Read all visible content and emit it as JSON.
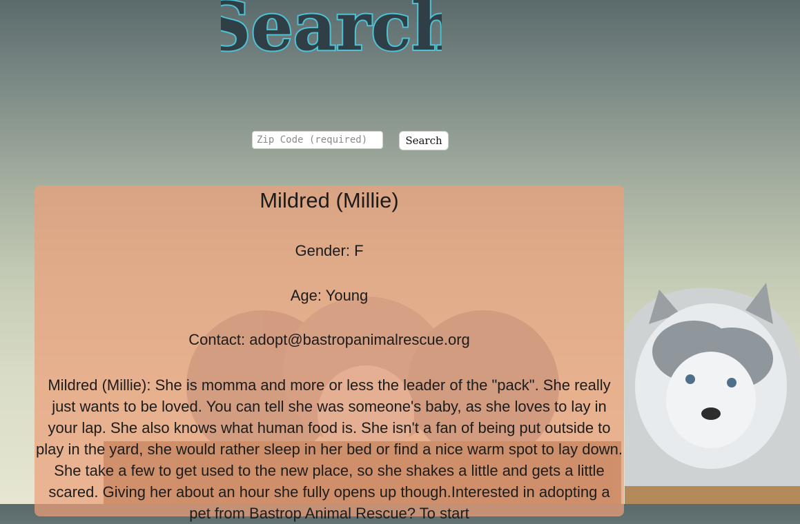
{
  "header": {
    "title": "Search"
  },
  "search": {
    "zip_placeholder": "Zip Code (required)",
    "zip_value": "",
    "button_label": "Search"
  },
  "pet": {
    "name": "Mildred (Millie)",
    "gender_label": "Gender: F",
    "age_label": "Age: Young",
    "contact_prefix": "Contact: ",
    "contact_email": "adopt@bastropanimalrescue.org",
    "description": "Mildred (Millie): She is momma and more or less the leader of the \"pack\". She really just wants to be loved. You can tell she was someone's baby, as she loves to lay in your lap. She also knows what human food is. She isn't a fan of being put outside to play in the yard, she would rather sleep in her bed or find a nice warm spot to lay down. She take a few to get used to the new place, so she shakes a little and gets a little scared. Giving her about an hour she fully opens up though.Interested in adopting a pet from Bastrop Animal Rescue? To start"
  },
  "colors": {
    "title_fill": "#2f3f45",
    "title_stroke": "#4fc3d6",
    "card_bg": "#eba078"
  }
}
